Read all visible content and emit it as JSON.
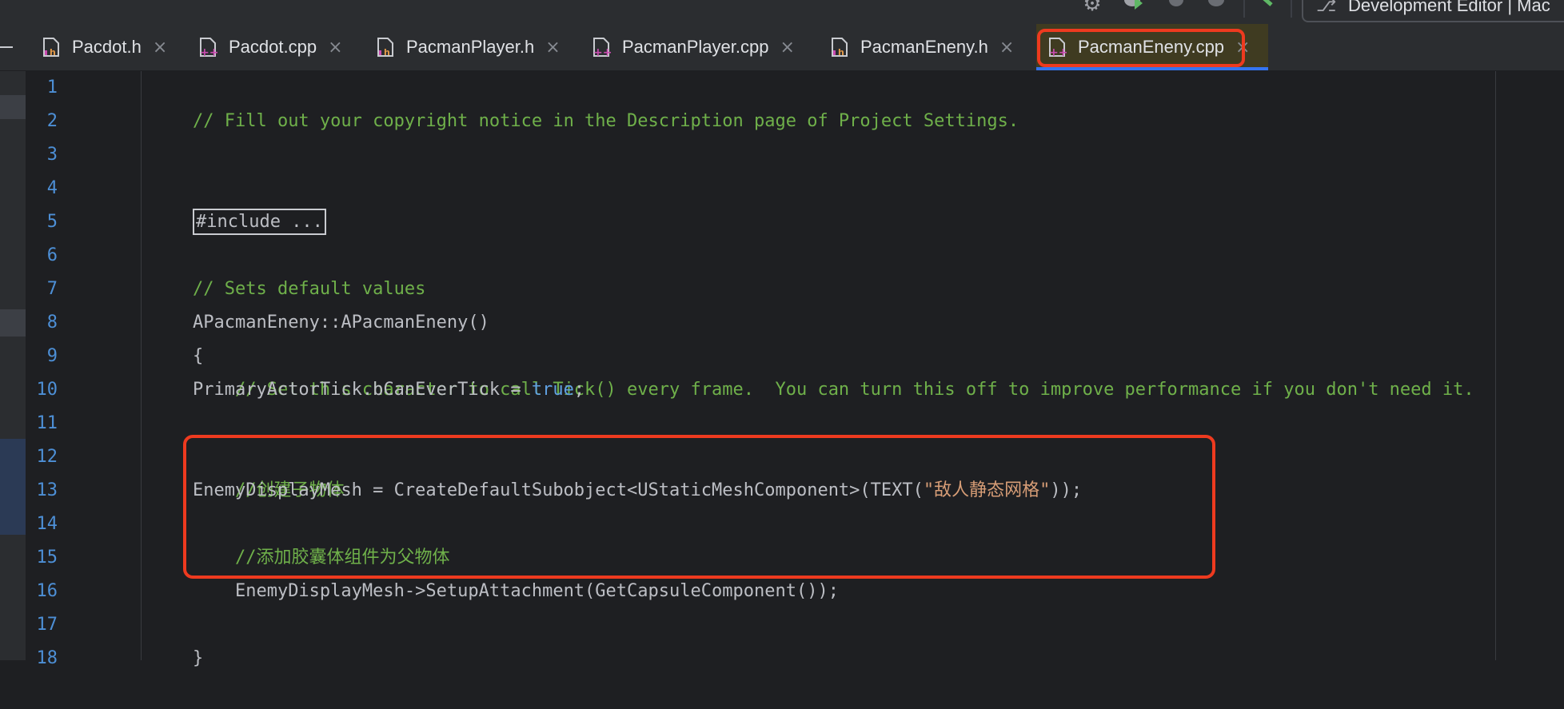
{
  "toolbar": {
    "run_config_label": "Development Editor | Mac"
  },
  "tabs": [
    {
      "label": "Pacdot.h",
      "type": "header"
    },
    {
      "label": "Pacdot.cpp",
      "type": "source"
    },
    {
      "label": "PacmanPlayer.h",
      "type": "header"
    },
    {
      "label": "PacmanPlayer.cpp",
      "type": "source"
    },
    {
      "label": "PacmanEneny.h",
      "type": "header"
    },
    {
      "label": "PacmanEneny.cpp",
      "type": "source",
      "active": true
    }
  ],
  "line_numbers": [
    "1",
    "2",
    "3",
    "4",
    "5",
    "6",
    "7",
    "8",
    "9",
    "10",
    "11",
    "12",
    "13",
    "14",
    "15",
    "16",
    "17",
    "18"
  ],
  "code": {
    "l1": "// Fill out your copyright notice in the Description page of Project Settings.",
    "l4": "#include ...",
    "l6": "// Sets default values",
    "l7": "APacmanEneny::APacmanEneny()",
    "l8": "{",
    "l9": "    // Set this character to call Tick() every frame.  You can turn this off to improve performance if you don't need it.",
    "l10_a": "    PrimaryActorTick.bCanEverTick = ",
    "l10_b": "true",
    "l10_c": ";",
    "l12": "    //创建子物体",
    "l13_a": "    EnemyDisplayMesh = CreateDefaultSubobject<UStaticMeshComponent>(TEXT(",
    "l13_b": "\"敌人静态网格\"",
    "l13_c": "));",
    "l14": "    //添加胶囊体组件为父物体",
    "l15": "    EnemyDisplayMesh->SetupAttachment(GetCapsuleComponent());",
    "l17": "}"
  },
  "colors": {
    "comment": "#6fb04a",
    "keyword": "#5f9fe0",
    "string": "#d79d76",
    "line_number": "#4d8fd6",
    "highlight_box": "#ee3a1f"
  }
}
